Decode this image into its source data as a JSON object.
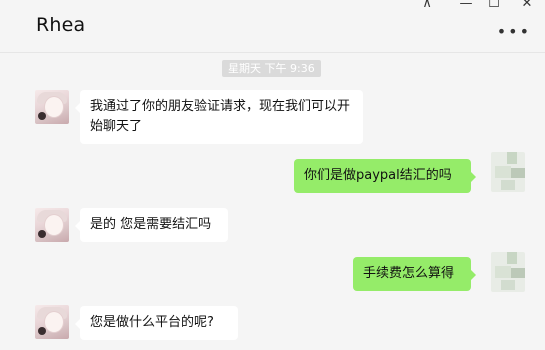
{
  "window": {
    "contact_name": "Rhea",
    "pin_glyph": "⊼",
    "minimize_glyph": "—",
    "maximize_glyph": "☐",
    "close_glyph": "✕",
    "more_glyph": "•••"
  },
  "chat": {
    "time_separator": "星期天 下午 9:36",
    "messages": [
      {
        "sender": "Rhea",
        "direction": "incoming",
        "text": "我通过了你的朋友验证请求，现在我们可以开始聊天了"
      },
      {
        "sender": "me",
        "direction": "outgoing",
        "text": "你们是做paypal结汇的吗"
      },
      {
        "sender": "Rhea",
        "direction": "incoming",
        "text": "是的 您是需要结汇吗"
      },
      {
        "sender": "me",
        "direction": "outgoing",
        "text": "手续费怎么算得"
      },
      {
        "sender": "Rhea",
        "direction": "incoming",
        "text": "您是做什么平台的呢?"
      }
    ]
  },
  "colors": {
    "incoming_bubble": "#ffffff",
    "outgoing_bubble": "#95ec69",
    "background": "#f5f5f5"
  }
}
